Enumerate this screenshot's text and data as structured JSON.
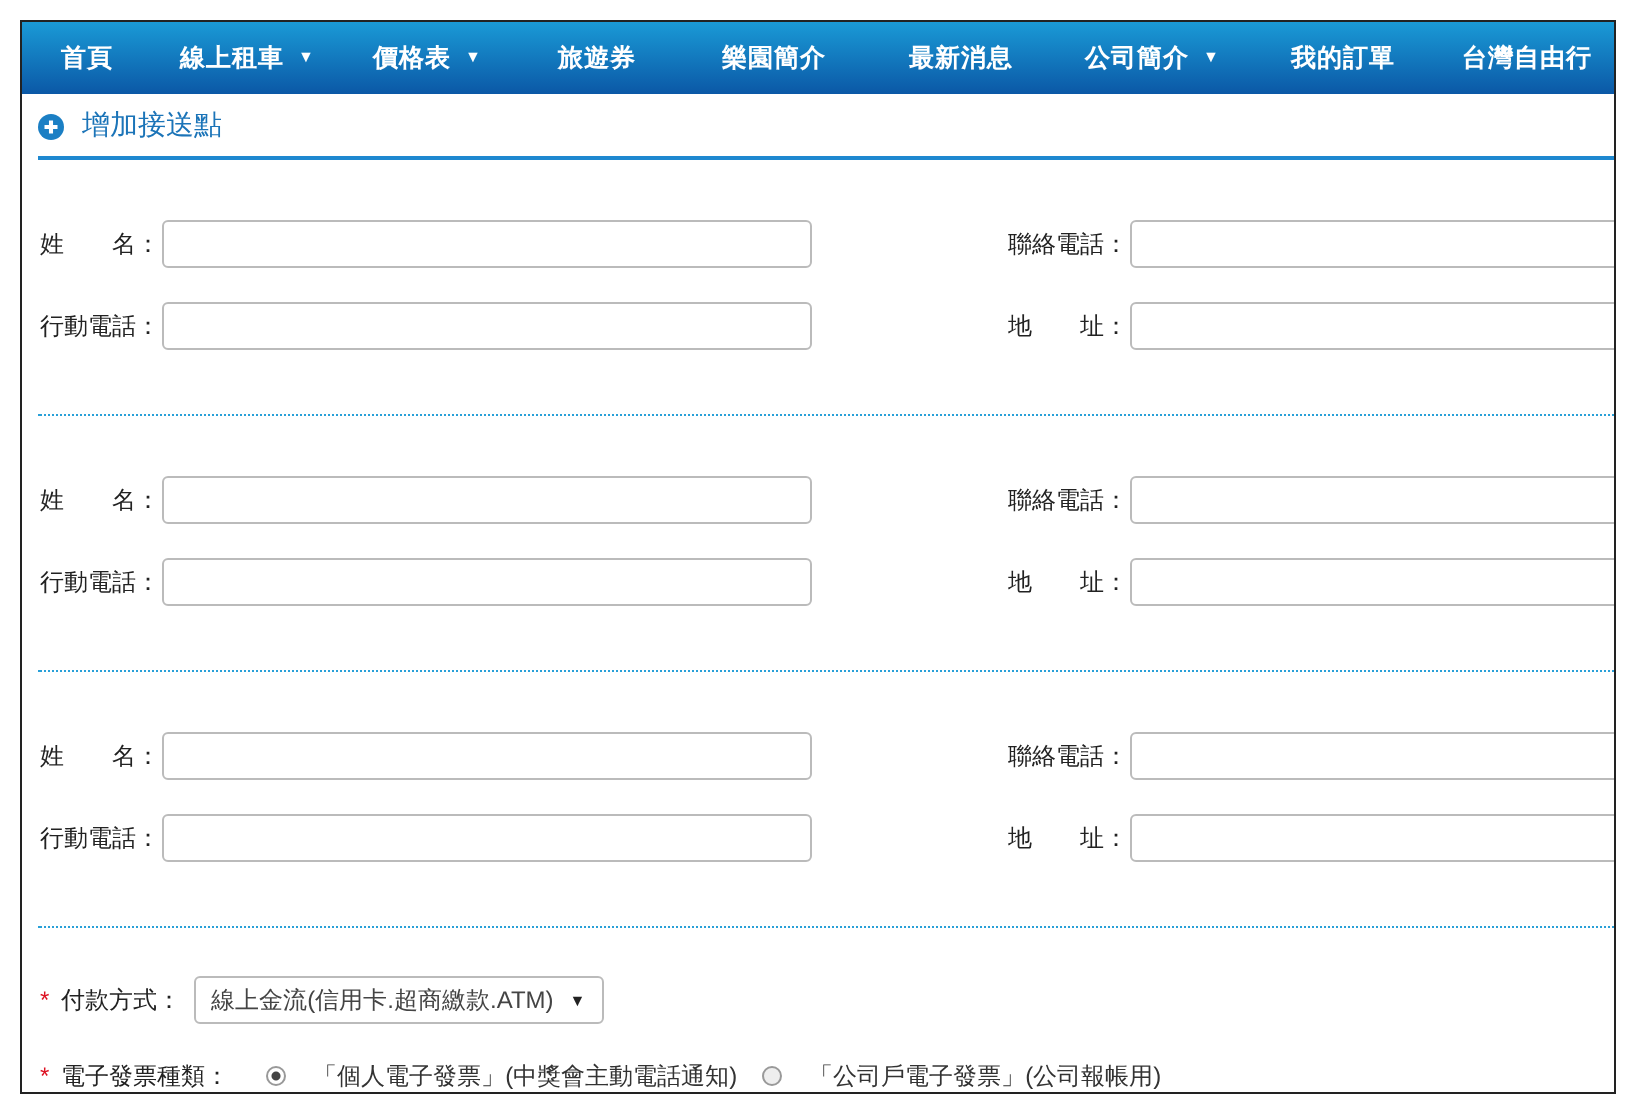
{
  "nav": [
    {
      "label": "首頁"
    },
    {
      "label": "線上租車",
      "caret": "▼"
    },
    {
      "label": "價格表",
      "caret": "▼"
    },
    {
      "label": "旅遊券"
    },
    {
      "label": "樂園簡介"
    },
    {
      "label": "最新消息"
    },
    {
      "label": "公司簡介",
      "caret": "▼"
    },
    {
      "label": "我的訂單"
    },
    {
      "label": "台灣自由行"
    }
  ],
  "section_title": "增加接送點",
  "contacts": [
    {
      "fields": [
        {
          "label": "姓　　名："
        },
        {
          "label": "聯絡電話："
        },
        {
          "label": "行動電話："
        },
        {
          "label": "地　　址："
        }
      ]
    },
    {
      "fields": [
        {
          "label": "姓　　名："
        },
        {
          "label": "聯絡電話："
        },
        {
          "label": "行動電話："
        },
        {
          "label": "地　　址："
        }
      ]
    },
    {
      "fields": [
        {
          "label": "姓　　名："
        },
        {
          "label": "聯絡電話："
        },
        {
          "label": "行動電話："
        },
        {
          "label": "地　　址："
        }
      ]
    }
  ],
  "payment": {
    "required_mark": "*",
    "label": "付款方式：",
    "value": "線上金流(信用卡.超商繳款.ATM)",
    "caret": "▼"
  },
  "invoice": {
    "required_mark": "*",
    "label": "電子發票種類：",
    "options": [
      {
        "label": "「個人電子發票」(中獎會主動電話通知)",
        "selected": true
      },
      {
        "label": "「公司戶電子發票」(公司報帳用)",
        "selected": false
      }
    ]
  }
}
